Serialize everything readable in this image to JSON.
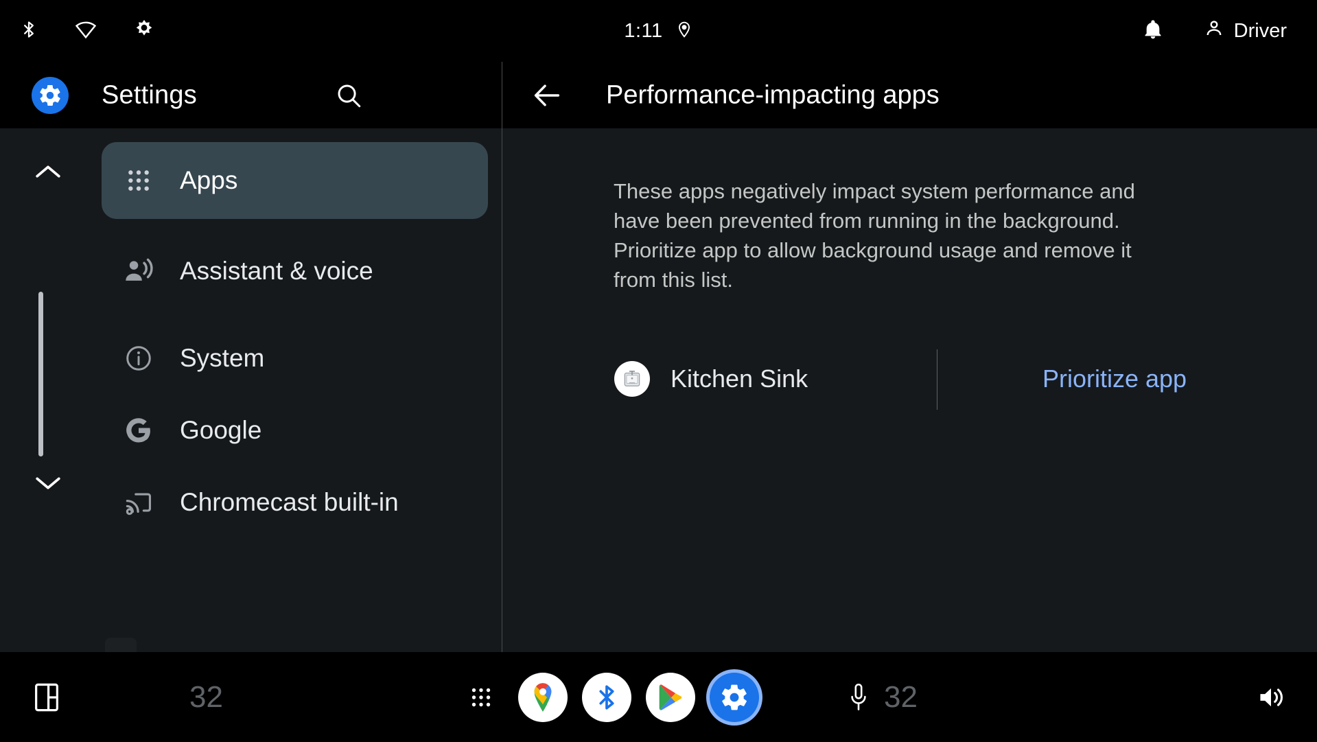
{
  "status_bar": {
    "icons_left": [
      "bluetooth-icon",
      "wifi-icon",
      "brightness-icon"
    ],
    "time": "1:11",
    "location_icon": "location-pin-icon",
    "notification_icon": "bell-icon",
    "user_icon": "person-icon",
    "user_label": "Driver"
  },
  "sidebar": {
    "app_icon": "settings-gear-icon",
    "title": "Settings",
    "search_icon": "search-icon",
    "scroll_up_icon": "chevron-up-icon",
    "scroll_down_icon": "chevron-down-icon",
    "items": [
      {
        "label": "Apps",
        "icon": "apps-grid-icon",
        "selected": true
      },
      {
        "label": "Assistant & voice",
        "icon": "assistant-voice-icon",
        "selected": false
      },
      {
        "label": "System",
        "icon": "info-circle-icon",
        "selected": false
      },
      {
        "label": "Google",
        "icon": "google-g-icon",
        "selected": false
      },
      {
        "label": "Chromecast built-in",
        "icon": "cast-icon",
        "selected": false
      }
    ]
  },
  "main": {
    "back_icon": "back-arrow-icon",
    "title": "Performance-impacting apps",
    "description": "These apps negatively impact system performance and have been prevented from running in the background.\nPrioritize app to allow background usage and remove it from this list.",
    "app_row": {
      "icon": "kitchen-sink-app-icon",
      "name": "Kitchen Sink",
      "action_label": "Prioritize app"
    }
  },
  "bottom_bar": {
    "panel_icon": "split-panel-icon",
    "temperature_left": "32",
    "temperature_right": "32",
    "grid_icon": "app-grid-icon",
    "apps": [
      {
        "name": "maps-icon",
        "active": false
      },
      {
        "name": "bluetooth-icon",
        "active": false
      },
      {
        "name": "play-store-icon",
        "active": false
      },
      {
        "name": "settings-icon",
        "active": true
      }
    ],
    "mic_icon": "microphone-icon",
    "volume_icon": "volume-icon"
  },
  "colors": {
    "accent_blue": "#1a73e8",
    "link_blue": "#8ab4f8",
    "selected_row": "#37474f",
    "panel_bg": "#16191c",
    "bar_bg": "#000000"
  }
}
